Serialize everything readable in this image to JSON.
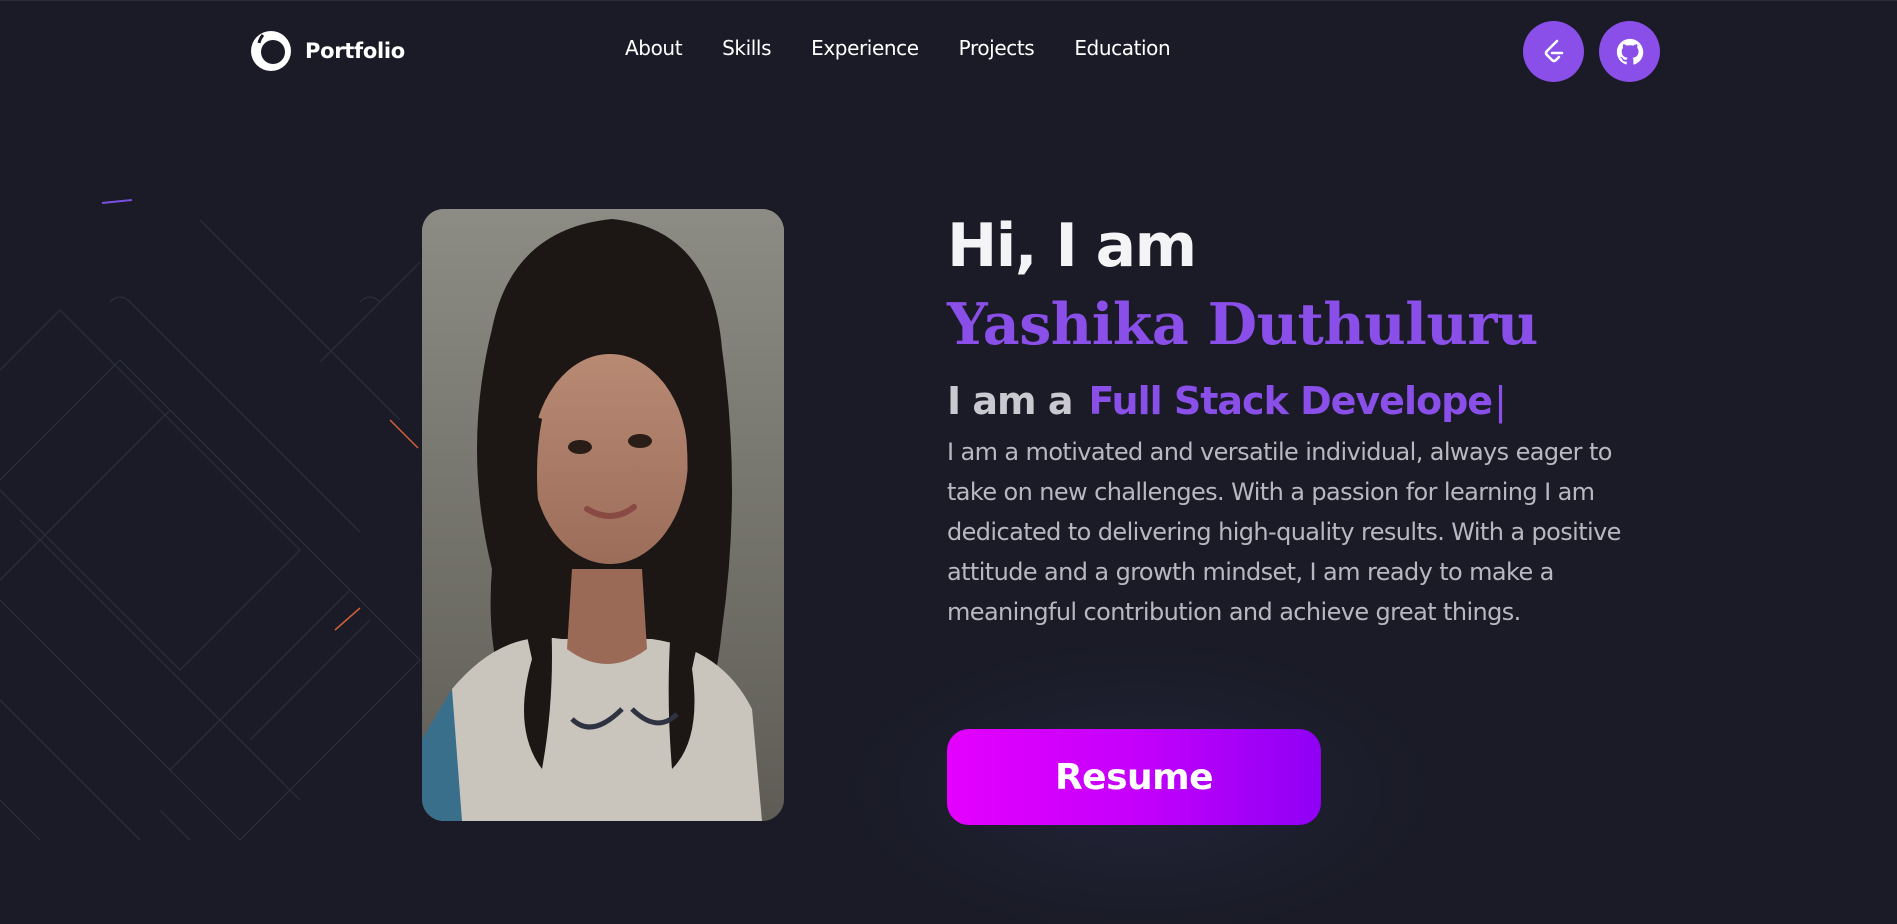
{
  "nav": {
    "brand": {
      "label": "Portfolio",
      "icon": "portfolio-logo-icon"
    },
    "links": [
      {
        "label": "About"
      },
      {
        "label": "Skills"
      },
      {
        "label": "Experience"
      },
      {
        "label": "Projects"
      },
      {
        "label": "Education"
      }
    ],
    "social": [
      {
        "icon": "leetcode-icon"
      },
      {
        "icon": "github-icon"
      }
    ]
  },
  "hero": {
    "greeting": "Hi, I am",
    "name": "Yashika Duthuluru",
    "role_prefix": "I am a",
    "role_value": "Full Stack Develope",
    "cursor": "|",
    "bio": "I am a motivated and versatile individual, always eager to take on new challenges. With a passion for learning I am dedicated to delivering high-quality results. With a positive attitude and a growth mindset, I am ready to make a meaningful contribution and achieve great things.",
    "resume_label": "Resume",
    "photo": "profile-photo"
  },
  "colors": {
    "background": "#1a1b26",
    "accent": "#8a4fe8",
    "button_gradient_start": "#e500ff",
    "button_gradient_end": "#8f00f5",
    "text_muted": "#b8b8c0"
  }
}
